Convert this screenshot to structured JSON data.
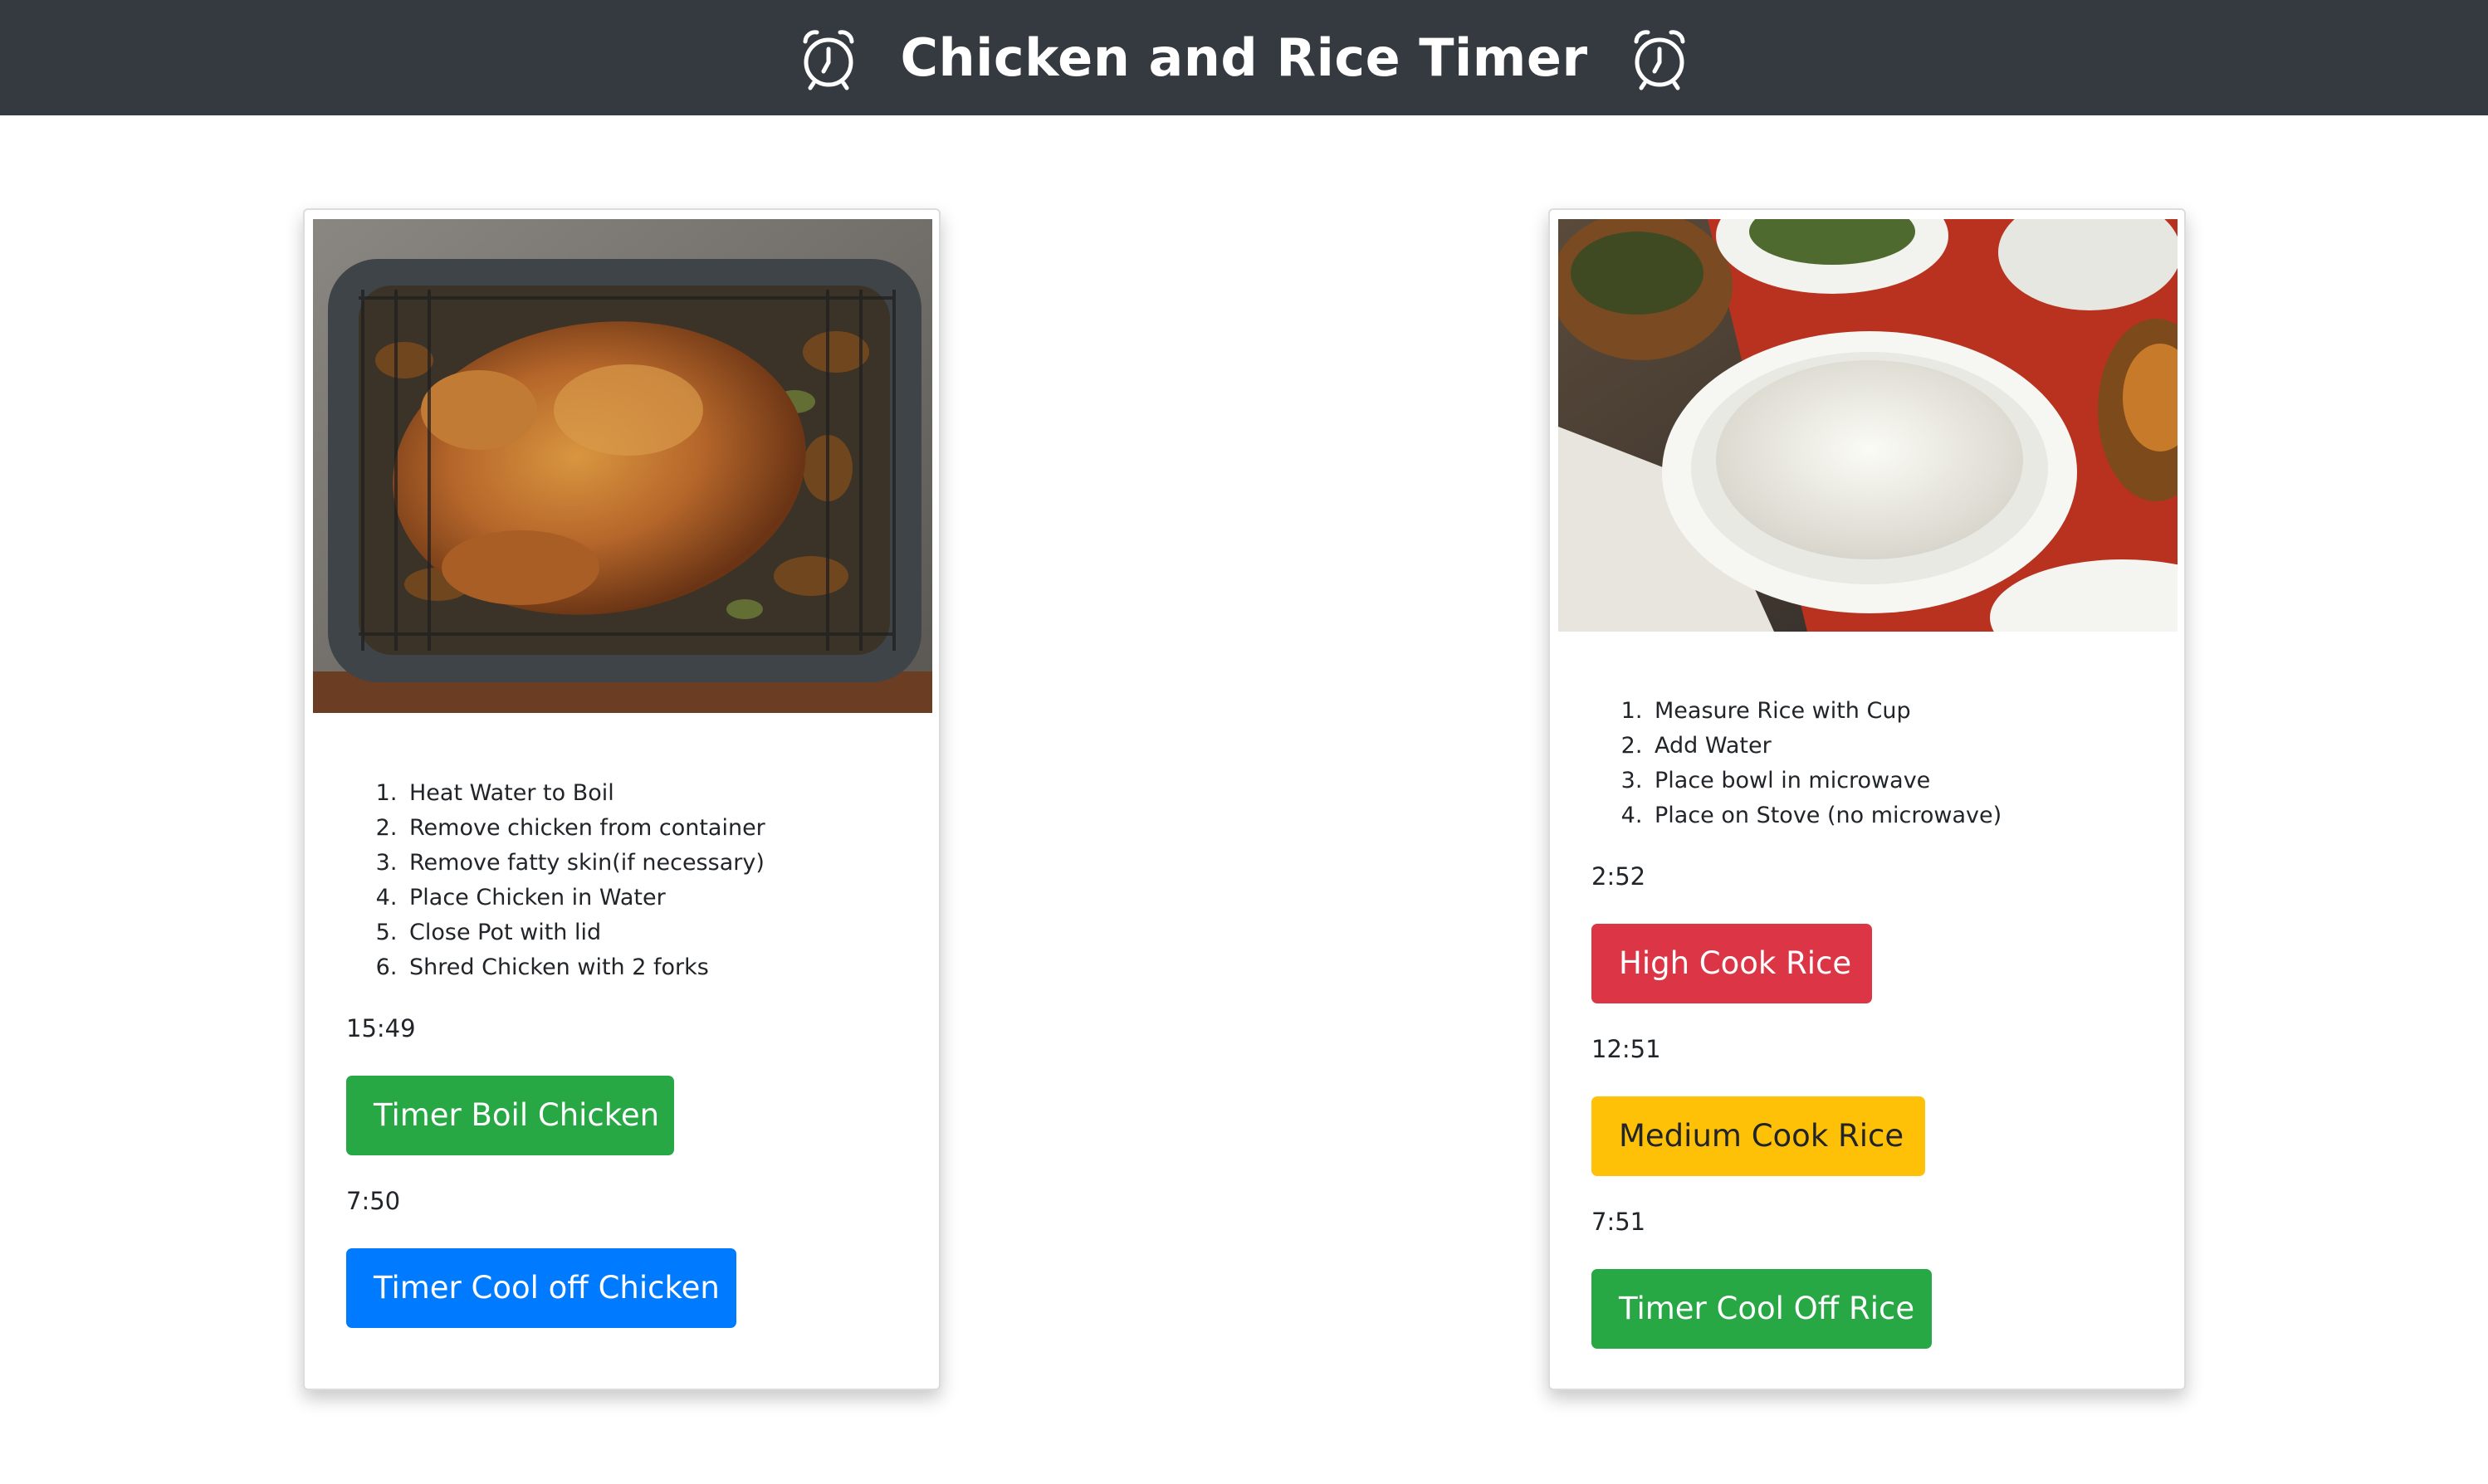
{
  "header": {
    "title": "Chicken and Rice Timer",
    "left_icon": "alarm-clock-icon",
    "right_icon": "alarm-clock-icon",
    "background": "#343a40"
  },
  "chicken": {
    "image": "roast-chicken-photo",
    "steps": [
      "Heat Water to Boil",
      "Remove chicken from container",
      "Remove fatty skin(if necessary)",
      "Place Chicken in Water",
      "Close Pot with lid",
      "Shred Chicken with 2 forks"
    ],
    "boil_time": "15:49",
    "boil_button": "Timer Boil Chicken",
    "cool_time": "7:50",
    "cool_button": "Timer Cool off Chicken"
  },
  "rice": {
    "image": "rice-bowl-photo",
    "steps": [
      "Measure Rice with Cup",
      "Add Water",
      "Place bowl in microwave",
      "Place on Stove (no microwave)"
    ],
    "high_time": "2:52",
    "high_button": "High Cook Rice",
    "medium_time": "12:51",
    "medium_button": "Medium Cook Rice",
    "cooloff_time": "7:51",
    "cooloff_button": "Timer Cool Off Rice"
  },
  "colors": {
    "green": "#28a745",
    "blue": "#007bff",
    "red": "#dc3545",
    "yellow": "#ffc107"
  }
}
